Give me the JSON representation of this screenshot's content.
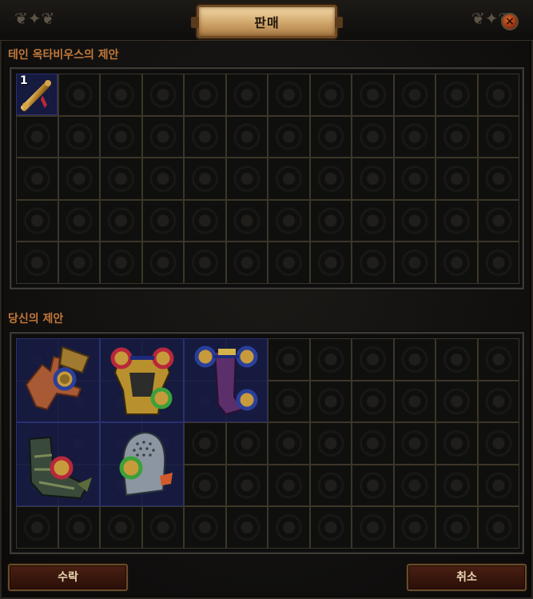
{
  "window": {
    "title": "판매",
    "close_label": "×"
  },
  "their_offer": {
    "label": "테인 옥타비우스의 제안",
    "items": [
      {
        "name": "map-scroll-item",
        "stack": "1"
      }
    ]
  },
  "your_offer": {
    "label": "당신의 제안",
    "items": [
      {
        "name": "gloves-item"
      },
      {
        "name": "chest-armour-item"
      },
      {
        "name": "boots-item"
      },
      {
        "name": "boots-green-item"
      },
      {
        "name": "helmet-item"
      }
    ]
  },
  "buttons": {
    "accept": "수락",
    "cancel": "취소"
  },
  "colors": {
    "section_label": "#c1783a",
    "item_background": "#161c46"
  }
}
